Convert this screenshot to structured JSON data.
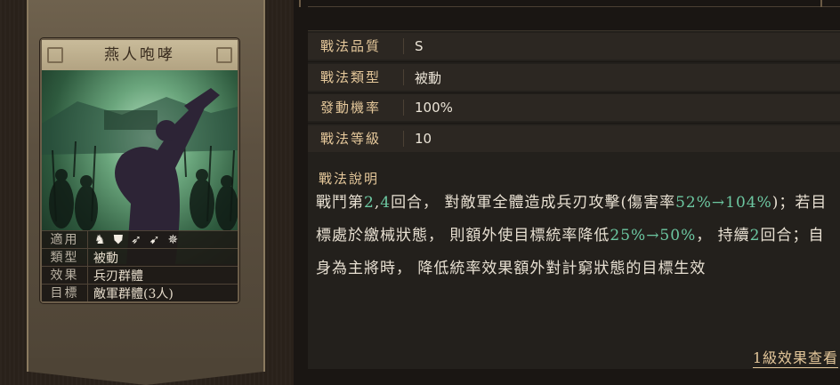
{
  "card": {
    "name": "燕人咆哮",
    "rows": [
      {
        "key": "適用",
        "value": ""
      },
      {
        "key": "類型",
        "value": "被動"
      },
      {
        "key": "效果",
        "value": "兵刃群體"
      },
      {
        "key": "目標",
        "value": "敵軍群體(3人)"
      }
    ],
    "troop_icons": [
      "cavalry-icon",
      "shield-icon",
      "bow-icon",
      "spear-icon",
      "wheel-icon"
    ]
  },
  "attributes": [
    {
      "key": "戰法品質",
      "value": "S"
    },
    {
      "key": "戰法類型",
      "value": "被動"
    },
    {
      "key": "發動機率",
      "value": "100%"
    },
    {
      "key": "戰法等級",
      "value": "10"
    }
  ],
  "description": {
    "title": "戰法說明",
    "parts": [
      {
        "text": "戰鬥第",
        "hl": false
      },
      {
        "text": "2",
        "hl": true
      },
      {
        "text": ",",
        "hl": false
      },
      {
        "text": "4",
        "hl": true
      },
      {
        "text": "回合， 對敵軍全體造成兵刃攻擊(傷害率",
        "hl": false
      },
      {
        "text": "52%→104%",
        "hl": true
      },
      {
        "text": ")；若目標處於繳械狀態， 則額外使目標統率降低",
        "hl": false
      },
      {
        "text": "25%→50%",
        "hl": true
      },
      {
        "text": "， 持續",
        "hl": false
      },
      {
        "text": "2",
        "hl": true
      },
      {
        "text": "回合；自身為主將時， 降低統率效果額外對計窮狀態的目標生效",
        "hl": false
      }
    ]
  },
  "more_link": "1級效果查看",
  "colors": {
    "accent": "#e4c79a",
    "highlight": "#6cc7a1"
  }
}
